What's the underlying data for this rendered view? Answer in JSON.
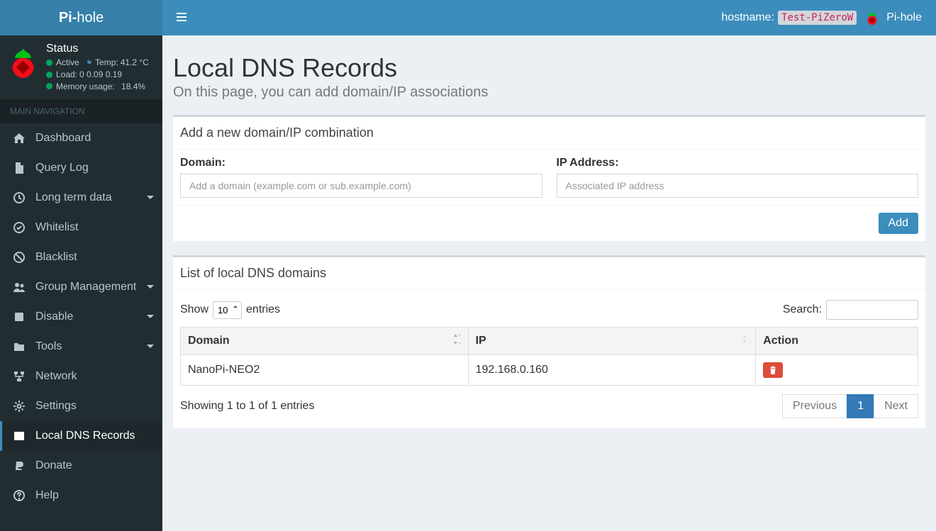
{
  "brand": {
    "pi": "Pi-",
    "hole": "hole",
    "name": "Pi-hole"
  },
  "topbar": {
    "hostname_label": "hostname:",
    "hostname_value": "Test-PiZeroW"
  },
  "status": {
    "title": "Status",
    "active": "Active",
    "temp_label": "Temp:",
    "temp_value": "41.2 °C",
    "load_label": "Load:",
    "load_values": "0  0.09  0.19",
    "mem_label": "Memory usage:",
    "mem_value": "18.4%"
  },
  "nav": {
    "header": "MAIN NAVIGATION",
    "items": [
      {
        "id": "dashboard",
        "label": "Dashboard",
        "icon": "home",
        "caret": false,
        "active": false
      },
      {
        "id": "querylog",
        "label": "Query Log",
        "icon": "file",
        "caret": false,
        "active": false
      },
      {
        "id": "longterm",
        "label": "Long term data",
        "icon": "clock",
        "caret": true,
        "active": false
      },
      {
        "id": "whitelist",
        "label": "Whitelist",
        "icon": "check",
        "caret": false,
        "active": false
      },
      {
        "id": "blacklist",
        "label": "Blacklist",
        "icon": "ban",
        "caret": false,
        "active": false
      },
      {
        "id": "groups",
        "label": "Group Management",
        "icon": "users",
        "caret": true,
        "active": false
      },
      {
        "id": "disable",
        "label": "Disable",
        "icon": "stop",
        "caret": true,
        "active": false
      },
      {
        "id": "tools",
        "label": "Tools",
        "icon": "folder",
        "caret": true,
        "active": false
      },
      {
        "id": "network",
        "label": "Network",
        "icon": "network",
        "caret": false,
        "active": false
      },
      {
        "id": "settings",
        "label": "Settings",
        "icon": "cog",
        "caret": false,
        "active": false
      },
      {
        "id": "localdns",
        "label": "Local DNS Records",
        "icon": "address",
        "caret": false,
        "active": true
      },
      {
        "id": "donate",
        "label": "Donate",
        "icon": "paypal",
        "caret": false,
        "active": false
      },
      {
        "id": "help",
        "label": "Help",
        "icon": "question",
        "caret": false,
        "active": false
      }
    ]
  },
  "page": {
    "title": "Local DNS Records",
    "subtitle": "On this page, you can add domain/IP associations"
  },
  "add": {
    "box_title": "Add a new domain/IP combination",
    "domain_label": "Domain:",
    "domain_placeholder": "Add a domain (example.com or sub.example.com)",
    "ip_label": "IP Address:",
    "ip_placeholder": "Associated IP address",
    "button": "Add"
  },
  "list": {
    "box_title": "List of local DNS domains",
    "length_pre": "Show",
    "length_value": "10",
    "length_post": "entries",
    "search_label": "Search:",
    "columns": {
      "domain": "Domain",
      "ip": "IP",
      "action": "Action"
    },
    "rows": [
      {
        "domain": "NanoPi-NEO2",
        "ip": "192.168.0.160"
      }
    ],
    "info": "Showing 1 to 1 of 1 entries",
    "prev": "Previous",
    "page": "1",
    "next": "Next"
  }
}
